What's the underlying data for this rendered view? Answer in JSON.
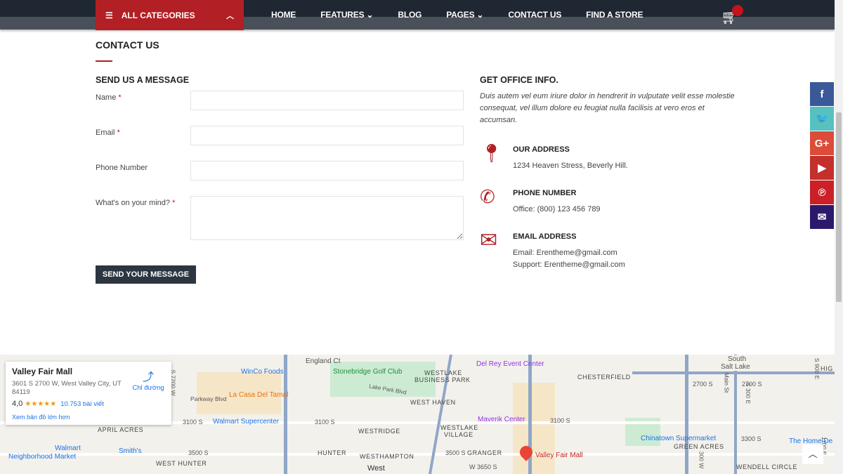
{
  "header": {
    "all_categories": "ALL CATEGORIES",
    "nav": [
      "HOME",
      "FEATURES ⌄",
      "BLOG",
      "PAGES ⌄",
      "CONTACT US",
      "FIND A STORE"
    ]
  },
  "page_title": "CONTACT US",
  "form": {
    "heading": "SEND US A MESSAGE",
    "name_label": "Name",
    "email_label": "Email",
    "phone_label": "Phone Number",
    "message_label": "What's on your mind?",
    "required_mark": "*",
    "submit": "SEND YOUR MESSAGE",
    "name_value": "",
    "email_value": "",
    "phone_value": "",
    "message_value": ""
  },
  "office": {
    "heading": "GET OFFICE INFO.",
    "intro": "Duis autem vel eum iriure dolor in hendrerit in vulputate velit esse molestie consequat, vel illum dolore eu feugiat nulla facilisis at vero eros et accumsan.",
    "address_title": "OUR ADDRESS",
    "address": "1234 Heaven Stress, Beverly Hill.",
    "phone_title": "PHONE NUMBER",
    "phone": "Office: (800) 123 456 789",
    "email_title": "EMAIL ADDRESS",
    "email": "Email: Erentheme@gmail.com",
    "support": "Support: Erentheme@gmail.com"
  },
  "social": [
    {
      "icon": "facebook-icon",
      "glyph": "f",
      "color": "#3b5998"
    },
    {
      "icon": "twitter-icon",
      "glyph": "🐦",
      "color": "#55c1c1"
    },
    {
      "icon": "google-plus-icon",
      "glyph": "G+",
      "color": "#dd4b39"
    },
    {
      "icon": "youtube-icon",
      "glyph": "▶",
      "color": "#c4302b"
    },
    {
      "icon": "pinterest-icon",
      "glyph": "℗",
      "color": "#cb2027"
    },
    {
      "icon": "envelope-icon",
      "glyph": "✉",
      "color": "#2b1a6b"
    }
  ],
  "map": {
    "card": {
      "title": "Valley Fair Mall",
      "address": "3601 S 2700 W, West Valley City, UT 84119",
      "rating": "4,0",
      "stars": "★★★★★",
      "reviews": "10.753 bài viết",
      "directions": "Chỉ đường",
      "larger": "Xem bản đồ lớn hơn"
    },
    "labels": [
      "England Ct",
      "WinCo Foods",
      "Stonebridge Golf Club",
      "WESTLAKE",
      "BUSINESS PARK",
      "Lake Park Blvd",
      "Del Rey Event Center",
      "CHESTERFIELD",
      "South",
      "Salt Lake",
      "HIG",
      "Parkway Blvd",
      "La Casa Del Tamal",
      "WEST HAVEN",
      "2700 S",
      "2700 S",
      "3100 S",
      "Walmart Supercenter",
      "3100 S",
      "Maverik Center",
      "3100 S",
      "APRIL ACRES",
      "WESTRIDGE",
      "WESTLAKE",
      "VILLAGE",
      "Walmart",
      "Neighborhood Market",
      "Smith's",
      "3500 S",
      "HUNTER",
      "WESTHAMPTON",
      "3500 S",
      "GRANGER",
      "Valley Fair Mall",
      "Chinatown Supermarket",
      "3300 S",
      "GREEN ACRES",
      "The Home De",
      "WEST HUNTER",
      "West",
      "W 3650 S",
      "WENDELL CIRCLE",
      "S 7200 W",
      "Main St",
      "S 300 E",
      "S 900 E",
      "1100 E",
      "300 W"
    ]
  }
}
